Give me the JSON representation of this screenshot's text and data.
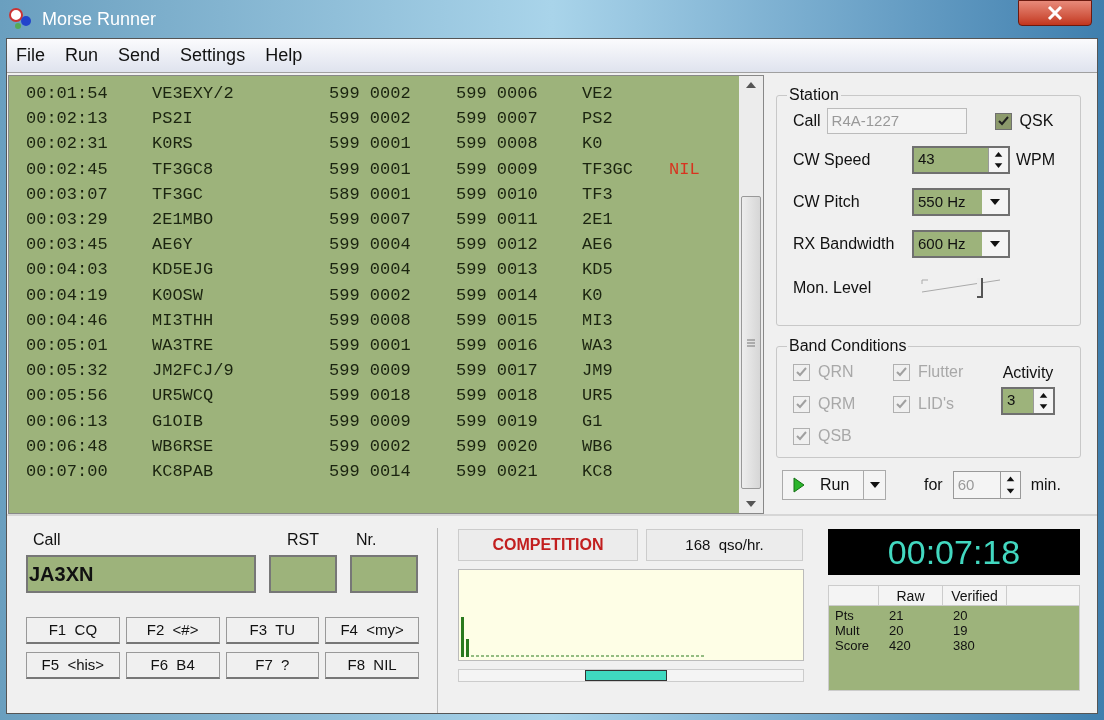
{
  "window": {
    "title": "Morse Runner"
  },
  "menu": [
    "File",
    "Run",
    "Send",
    "Settings",
    "Help"
  ],
  "log": [
    {
      "time": "00:01:54",
      "call": "VE3EXY/2",
      "sent": "599 0002",
      "received": "599 0006",
      "prefix": "VE2"
    },
    {
      "time": "00:02:13",
      "call": "PS2I",
      "sent": "599 0002",
      "received": "599 0007",
      "prefix": "PS2"
    },
    {
      "time": "00:02:31",
      "call": "K0RS",
      "sent": "599 0001",
      "received": "599 0008",
      "prefix": "K0"
    },
    {
      "time": "00:02:45",
      "call": "TF3GC8",
      "sent": "599 0001",
      "received": "599 0009",
      "prefix": "TF3GC",
      "remark": "NIL"
    },
    {
      "time": "00:03:07",
      "call": "TF3GC",
      "sent": "589 0001",
      "received": "599 0010",
      "prefix": "TF3"
    },
    {
      "time": "00:03:29",
      "call": "2E1MBO",
      "sent": "599 0007",
      "received": "599 0011",
      "prefix": "2E1"
    },
    {
      "time": "00:03:45",
      "call": "AE6Y",
      "sent": "599 0004",
      "received": "599 0012",
      "prefix": "AE6"
    },
    {
      "time": "00:04:03",
      "call": "KD5EJG",
      "sent": "599 0004",
      "received": "599 0013",
      "prefix": "KD5"
    },
    {
      "time": "00:04:19",
      "call": "K0OSW",
      "sent": "599 0002",
      "received": "599 0014",
      "prefix": "K0"
    },
    {
      "time": "00:04:46",
      "call": "MI3THH",
      "sent": "599 0008",
      "received": "599 0015",
      "prefix": "MI3"
    },
    {
      "time": "00:05:01",
      "call": "WA3TRE",
      "sent": "599 0001",
      "received": "599 0016",
      "prefix": "WA3"
    },
    {
      "time": "00:05:32",
      "call": "JM2FCJ/9",
      "sent": "599 0009",
      "received": "599 0017",
      "prefix": "JM9"
    },
    {
      "time": "00:05:56",
      "call": "UR5WCQ",
      "sent": "599 0018",
      "received": "599 0018",
      "prefix": "UR5"
    },
    {
      "time": "00:06:13",
      "call": "G1OIB",
      "sent": "599 0009",
      "received": "599 0019",
      "prefix": "G1"
    },
    {
      "time": "00:06:48",
      "call": "WB6RSE",
      "sent": "599 0002",
      "received": "599 0020",
      "prefix": "WB6"
    },
    {
      "time": "00:07:00",
      "call": "KC8PAB",
      "sent": "599 0014",
      "received": "599 0021",
      "prefix": "KC8"
    }
  ],
  "station": {
    "title": "Station",
    "call_label": "Call",
    "call_value": "R4A-1227",
    "qsk": {
      "label": "QSK",
      "checked": true
    },
    "cw_speed": {
      "label": "CW Speed",
      "value": "43",
      "unit": "WPM"
    },
    "cw_pitch": {
      "label": "CW Pitch",
      "value": "550 Hz"
    },
    "rx_bandwidth": {
      "label": "RX Bandwidth",
      "value": "600 Hz"
    },
    "mon_level": {
      "label": "Mon. Level",
      "level": 0.75
    }
  },
  "band_conditions": {
    "title": "Band Conditions",
    "options": [
      {
        "label": "QRN",
        "checked": true,
        "disabled": true
      },
      {
        "label": "QRM",
        "checked": true,
        "disabled": true
      },
      {
        "label": "QSB",
        "checked": true,
        "disabled": true
      },
      {
        "label": "Flutter",
        "checked": true,
        "disabled": true
      },
      {
        "label": "LID's",
        "checked": true,
        "disabled": true
      }
    ],
    "activity": {
      "label": "Activity",
      "value": "3"
    }
  },
  "run": {
    "button": "Run",
    "for_label": "for",
    "minutes": "60",
    "unit": "min."
  },
  "entry": {
    "call_label": "Call",
    "call_value": "JA3XN",
    "rst_label": "RST",
    "nr_label": "Nr."
  },
  "function_keys": [
    "F1  CQ",
    "F2  <#>",
    "F3  TU",
    "F4  <my>",
    "F5  <his>",
    "F6  B4",
    "F7  ?",
    "F8  NIL"
  ],
  "mode": "COMPETITION",
  "rate": "168  qso/hr.",
  "clock": "00:07:18",
  "score": {
    "columns": [
      "Raw",
      "Verified"
    ],
    "rows": [
      {
        "label": "Pts",
        "raw": "21",
        "verified": "20"
      },
      {
        "label": "Mult",
        "raw": "20",
        "verified": "19"
      },
      {
        "label": "Score",
        "raw": "420",
        "verified": "380"
      }
    ]
  }
}
